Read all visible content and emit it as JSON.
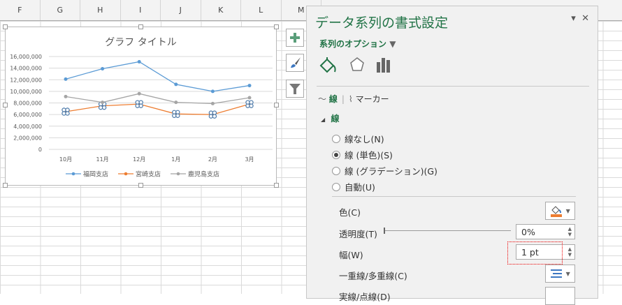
{
  "columns": [
    "F",
    "G",
    "H",
    "I",
    "J",
    "K",
    "L",
    "M"
  ],
  "chart_data": {
    "type": "line",
    "title": "グラフ タイトル",
    "categories": [
      "10月",
      "11月",
      "12月",
      "1月",
      "2月",
      "3月"
    ],
    "yticks": [
      "0",
      "2,000,000",
      "4,000,000",
      "6,000,000",
      "8,000,000",
      "10,000,000",
      "12,000,000",
      "14,000,000",
      "16,000,000"
    ],
    "ylim": [
      0,
      16000000
    ],
    "legend_position": "bottom",
    "series": [
      {
        "name": "福岡支店",
        "color": "#5b9bd5",
        "values": [
          12100000,
          13900000,
          15100000,
          11200000,
          10000000,
          11000000
        ]
      },
      {
        "name": "宮崎支店",
        "color": "#ed7d31",
        "values": [
          6500000,
          7500000,
          7800000,
          6100000,
          6000000,
          7800000
        ],
        "selected": true
      },
      {
        "name": "鹿児島支店",
        "color": "#a5a5a5",
        "values": [
          9100000,
          8100000,
          9600000,
          8100000,
          7900000,
          8900000
        ]
      }
    ]
  },
  "panel": {
    "title": "データ系列の書式設定",
    "series_options": "系列のオプション",
    "subtabs": [
      "線",
      "マーカー"
    ],
    "section": "線",
    "radios": [
      {
        "label": "線なし(N)",
        "checked": false
      },
      {
        "label": "線 (単色)(S)",
        "checked": true
      },
      {
        "label": "線 (グラデーション)(G)",
        "checked": false
      },
      {
        "label": "自動(U)",
        "checked": false
      }
    ],
    "color_label": "色(C)",
    "color_value": "#ed7d31",
    "transparency_label": "透明度(T)",
    "transparency_value": "0%",
    "width_label": "幅(W)",
    "width_value": "1 pt",
    "compound_label": "一重線/多重線(C)",
    "dash_label": "実線/点線(D)"
  }
}
